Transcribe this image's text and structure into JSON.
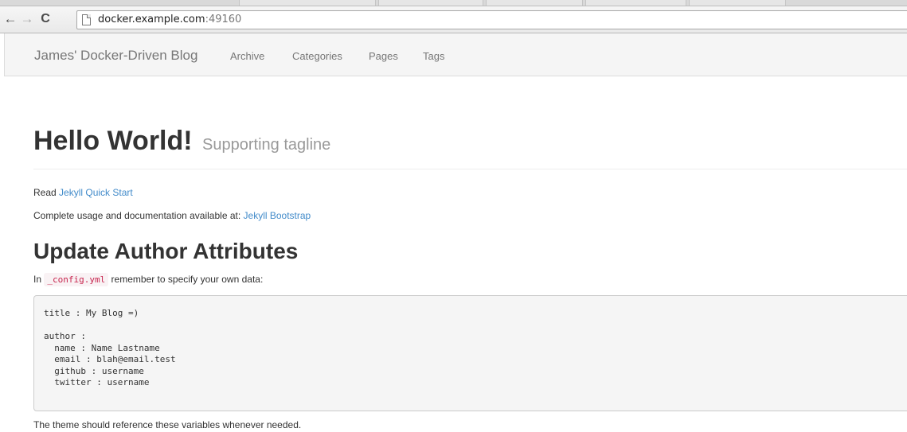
{
  "browser": {
    "back_icon": "←",
    "forward_icon": "→",
    "reload_icon": "C",
    "url_host": "docker.example.com",
    "url_port": ":49160"
  },
  "navbar": {
    "brand": "James' Docker-Driven Blog",
    "links": [
      "Archive",
      "Categories",
      "Pages",
      "Tags"
    ]
  },
  "page": {
    "title": "Hello World!",
    "tagline": "Supporting tagline",
    "read_prefix": "Read ",
    "read_link": "Jekyll Quick Start",
    "docs_prefix": "Complete usage and documentation available at: ",
    "docs_link": "Jekyll Bootstrap",
    "section_heading": "Update Author Attributes",
    "config_prefix": "In ",
    "config_file": "_config.yml",
    "config_suffix": " remember to specify your own data:",
    "code_block": "title : My Blog =)\n\nauthor :\n  name : Name Lastname\n  email : blah@email.test\n  github : username\n  twitter : username",
    "footer_text": "The theme should reference these variables whenever needed."
  }
}
